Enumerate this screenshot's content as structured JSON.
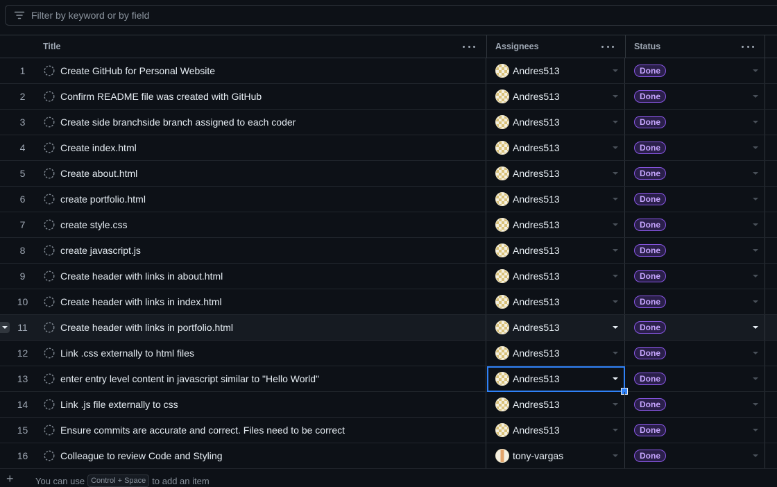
{
  "filter": {
    "placeholder": "Filter by keyword or by field"
  },
  "columns": {
    "title": "Title",
    "assignees": "Assignees",
    "status": "Status"
  },
  "rows": [
    {
      "num": "1",
      "title": "Create GitHub for Personal Website",
      "assignee": "Andres513",
      "status": "Done"
    },
    {
      "num": "2",
      "title": "Confirm README file was created with GitHub",
      "assignee": "Andres513",
      "status": "Done"
    },
    {
      "num": "3",
      "title": "Create side branchside branch assigned to each coder",
      "assignee": "Andres513",
      "status": "Done"
    },
    {
      "num": "4",
      "title": "Create index.html",
      "assignee": "Andres513",
      "status": "Done"
    },
    {
      "num": "5",
      "title": "Create about.html",
      "assignee": "Andres513",
      "status": "Done"
    },
    {
      "num": "6",
      "title": "create portfolio.html",
      "assignee": "Andres513",
      "status": "Done"
    },
    {
      "num": "7",
      "title": "create style.css",
      "assignee": "Andres513",
      "status": "Done"
    },
    {
      "num": "8",
      "title": "create javascript.js",
      "assignee": "Andres513",
      "status": "Done"
    },
    {
      "num": "9",
      "title": "Create header with links in about.html",
      "assignee": "Andres513",
      "status": "Done"
    },
    {
      "num": "10",
      "title": "Create header with links in index.html",
      "assignee": "Andres513",
      "status": "Done"
    },
    {
      "num": "11",
      "title": "Create header with links in portfolio.html",
      "assignee": "Andres513",
      "status": "Done"
    },
    {
      "num": "12",
      "title": "Link .css externally to html files",
      "assignee": "Andres513",
      "status": "Done"
    },
    {
      "num": "13",
      "title": "enter entry level content in javascript similar to \"Hello World\"",
      "assignee": "Andres513",
      "status": "Done"
    },
    {
      "num": "14",
      "title": "Link .js file externally to css",
      "assignee": "Andres513",
      "status": "Done"
    },
    {
      "num": "15",
      "title": "Ensure commits are accurate and correct. Files need to be correct",
      "assignee": "Andres513",
      "status": "Done"
    },
    {
      "num": "16",
      "title": "Colleague to review Code and Styling",
      "assignee": "tony-vargas",
      "status": "Done"
    }
  ],
  "footer": {
    "plus": "+",
    "prefix": "You can use",
    "key": "Control + Space",
    "suffix": "to add an item"
  },
  "icons": {
    "filter": "filter-icon",
    "draft": "draft-issue-icon",
    "menu": "kebab-menu-icon",
    "caret": "caret-down-icon"
  },
  "colors": {
    "accent": "#2f81f7",
    "done_badge": "#8957e5"
  }
}
